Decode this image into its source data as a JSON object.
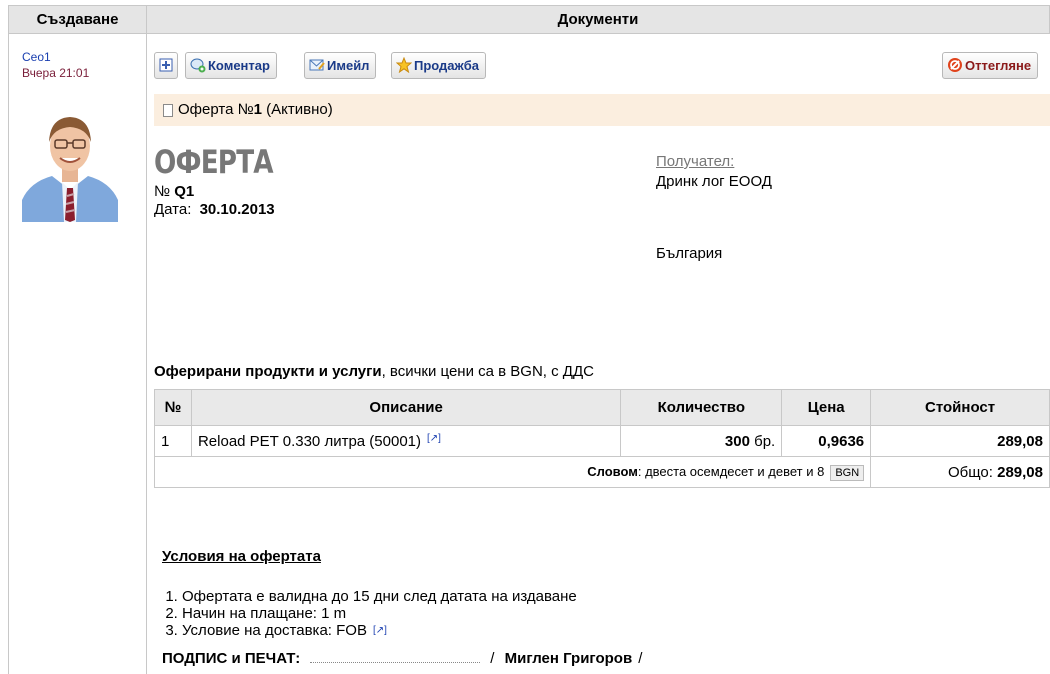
{
  "headers": {
    "left": "Създаване",
    "right": "Документи"
  },
  "author": {
    "name": "Ceo1",
    "time": "Вчера 21:01"
  },
  "toolbar": {
    "add_icon": "plus-icon",
    "comment": "Коментар",
    "email": "Имейл",
    "sale": "Продажба",
    "reject": "Оттегляне"
  },
  "document": {
    "prefix": "Оферта №",
    "number": "1",
    "status": " (Активно)"
  },
  "offer": {
    "title": "ОФЕРТА",
    "no_label": "№",
    "no_value": "Q1",
    "date_label": "Дата:",
    "date_value": "30.10.2013",
    "recipient_label": "Получател:",
    "recipient": "Дринк лог ЕООД",
    "country": "България"
  },
  "products": {
    "heading": "Оферирани продукти и услуги",
    "note": ",  всички цени са в BGN, с ДДС",
    "columns": [
      "№",
      "Описание",
      "Количество",
      "Цена",
      "Стойност"
    ],
    "rows": [
      {
        "no": "1",
        "description": "Reload PET 0.330 литра (50001)",
        "ext": "[↗]",
        "qty": "300",
        "unit": "бр.",
        "price": "0,9636",
        "amount": "289,08"
      }
    ],
    "words_label": "Словом",
    "words": ": двеста осемдесет и девет и 8",
    "currency": "BGN",
    "total_label": "Общо:",
    "total": "289,08"
  },
  "conditions": {
    "title": "Условия на офертата",
    "items": [
      "Офертата е валидна до 15 дни след датата на издаване",
      "Начин на плащане: 1 m",
      "Условие на доставка: FOB"
    ],
    "ext": "[↗]"
  },
  "signature": {
    "label": "ПОДПИС и ПЕЧАТ:",
    "slash": "/",
    "name": "Миглен Григоров",
    "slash_end": "/"
  }
}
